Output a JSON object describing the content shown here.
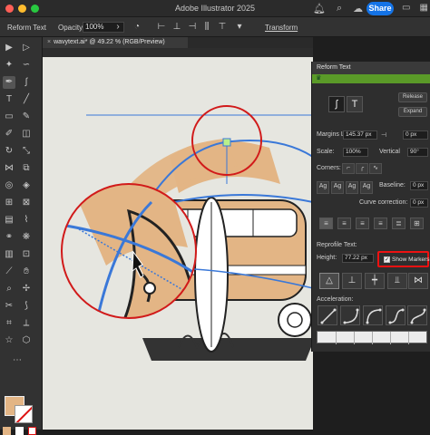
{
  "app": {
    "title": "Adobe Illustrator 2025",
    "share_label": "Share"
  },
  "control_bar": {
    "selection_label": "Reform Text",
    "opacity_label": "Opacity:",
    "opacity_value": "100%",
    "transform_label": "Transform"
  },
  "document": {
    "tab_close": "×",
    "tab_title": "wavytext.ai* @ 49.22 % (RGB/Preview)"
  },
  "colors": {
    "fill": "#e3b585",
    "selection": "#3a78d8",
    "annotation": "#d11a1a",
    "panel_strip": "#5a9a28"
  },
  "panel": {
    "title": "Reform Text",
    "release_label": "Release",
    "expand_label": "Expand",
    "margins_label": "Margins L:",
    "margins_value": "145.37 px",
    "margins_r_value": "0 px",
    "scale_label": "Scale:",
    "scale_value": "100%",
    "vertical_label": "Vertical",
    "vertical_value": "90°",
    "corners_label": "Corners:",
    "baseline_label": "Baseline:",
    "baseline_value": "0 px",
    "curve_label": "Curve correction:",
    "curve_value": "0 px",
    "reprofile_label": "Reprofile Text:",
    "height_label": "Height:",
    "height_value": "77.22 px",
    "show_markers_label": "Show Markers",
    "show_markers_checked": "✓",
    "acceleration_label": "Acceleration:"
  }
}
